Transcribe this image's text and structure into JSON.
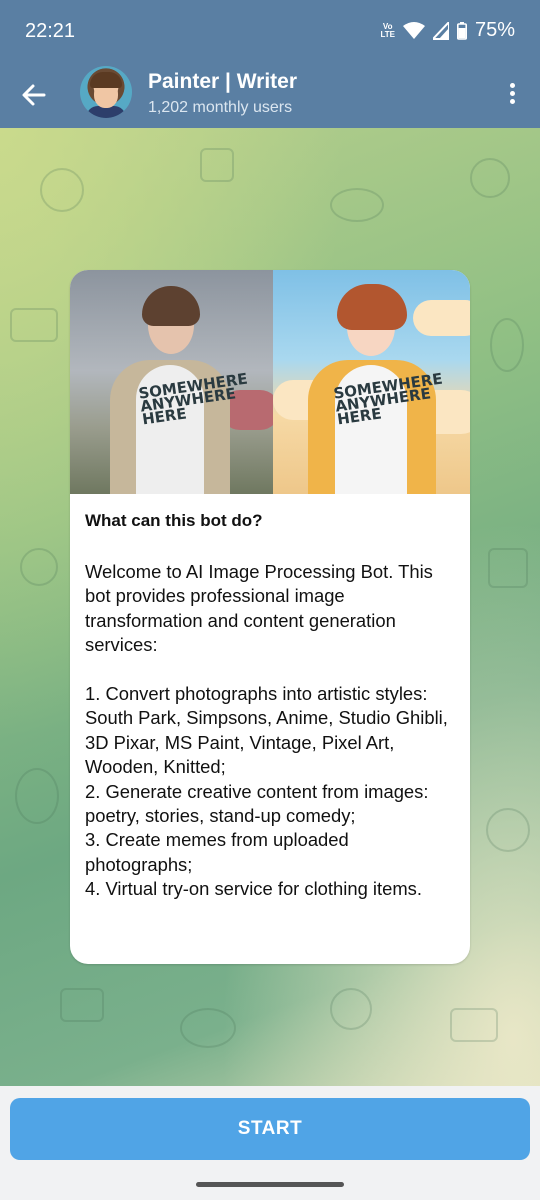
{
  "status_bar": {
    "time": "22:21",
    "volte_top": "Vo",
    "volte_bottom": "LTE",
    "battery": "75%"
  },
  "header": {
    "title": "Painter | Writer",
    "subtitle": "1,202 monthly users"
  },
  "card": {
    "shirt_text_left": "SOMEWHERE\nANYWHERE\nHERE",
    "shirt_text_right": "SOMEWHERE\nANYWHERE\nHERE",
    "heading": "What can this bot do?",
    "body": "Welcome to AI Image Processing Bot. This bot provides professional image transformation and content generation services:\n\n1. Convert photographs into artistic styles: South Park, Simpsons, Anime, Studio Ghibli, 3D Pixar, MS Paint, Vintage, Pixel Art, Wooden, Knitted;\n2. Generate creative content from images: poetry, stories, stand-up comedy;\n3. Create memes from uploaded photographs;\n4. Virtual try-on service for clothing items."
  },
  "bottom": {
    "start_label": "START"
  },
  "colors": {
    "header": "#5a7fa3",
    "start_button": "#50a4e6"
  }
}
